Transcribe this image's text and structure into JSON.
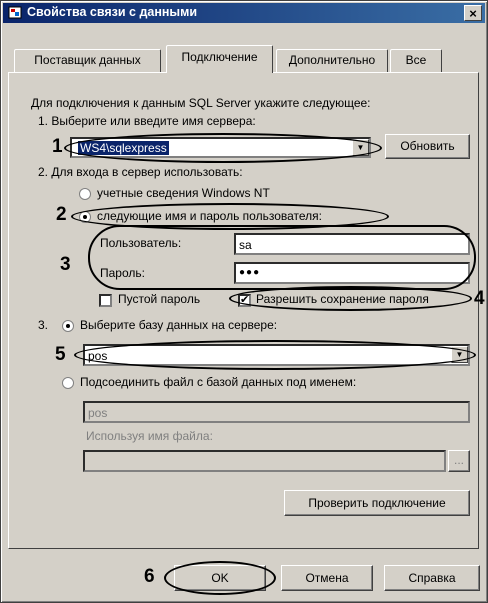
{
  "window": {
    "title": "Свойства связи с данными",
    "close": "×"
  },
  "tabs": [
    "Поставщик данных",
    "Подключение",
    "Дополнительно",
    "Все"
  ],
  "intro": "Для подключения к данным SQL Server укажите следующее:",
  "step1": {
    "label": "1. Выберите или введите имя сервера:",
    "server": "WS4\\sqlexpress",
    "refresh": "Обновить"
  },
  "step2": {
    "label": "2. Для входа в сервер использовать:",
    "radio_nt": "учетные сведения Windows NT",
    "radio_user": "следующие имя и пароль пользователя:",
    "user_label": "Пользователь:",
    "user_value": "sa",
    "pass_label": "Пароль:",
    "pass_value": "●●●",
    "empty_pass": "Пустой пароль",
    "save_pass": "Разрешить сохранение пароля"
  },
  "step3": {
    "num": "3.",
    "radio_db": "Выберите базу данных на сервере:",
    "db_value": "pos",
    "radio_file": "Подсоединить файл с базой данных под именем:",
    "file_db": "pos",
    "file_name_label": "Используя имя файла:",
    "browse": "...",
    "test": "Проверить подключение"
  },
  "footer": {
    "ok": "OK",
    "cancel": "Отмена",
    "help": "Справка"
  },
  "callouts": [
    "1",
    "2",
    "3",
    "4",
    "5",
    "6"
  ],
  "colors": {
    "title_from": "#0a246a",
    "title_to": "#3a6ea5",
    "face": "#d4d0c8"
  }
}
